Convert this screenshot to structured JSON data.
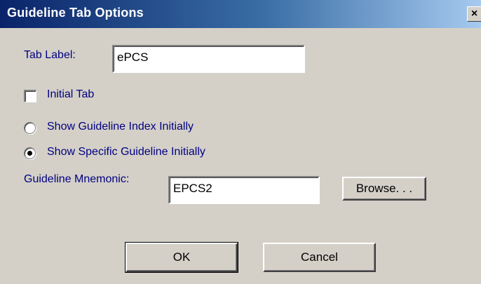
{
  "window": {
    "title": "Guideline Tab Options",
    "close_glyph": "×"
  },
  "tab_label": {
    "label": "Tab Label:",
    "value": "ePCS"
  },
  "initial_tab": {
    "label": "Initial Tab",
    "checked": false
  },
  "radio_index": {
    "label": "Show Guideline Index Initially",
    "checked": false
  },
  "radio_specific": {
    "label": "Show Specific Guideline Initially",
    "checked": true
  },
  "mnemonic": {
    "label": "Guideline Mnemonic:",
    "value": "EPCS2",
    "browse_label": "Browse. . ."
  },
  "footer": {
    "ok_label": "OK",
    "cancel_label": "Cancel"
  },
  "colors": {
    "face": "#d4d0c8",
    "label_text": "#000080",
    "title_bar": "#0a246a"
  }
}
